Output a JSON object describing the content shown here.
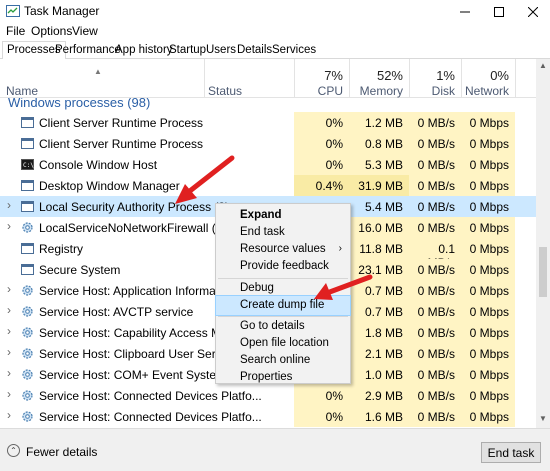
{
  "window": {
    "title": "Task Manager"
  },
  "menu": [
    "File",
    "Options",
    "View"
  ],
  "tabs": [
    "Processes",
    "Performance",
    "App history",
    "Startup",
    "Users",
    "Details",
    "Services"
  ],
  "header": {
    "name": "Name",
    "status": "Status",
    "cpu_pct": "7%",
    "cpu_label": "CPU",
    "mem_pct": "52%",
    "mem_label": "Memory",
    "disk_pct": "1%",
    "disk_label": "Disk",
    "net_pct": "0%",
    "net_label": "Network"
  },
  "group": {
    "title": "Windows processes (98)"
  },
  "processes": [
    {
      "name": "Client Server Runtime Process",
      "cpu": "0%",
      "mem": "1.2 MB",
      "disk": "0 MB/s",
      "net": "0 Mbps",
      "icon": "window-icon",
      "expandable": false
    },
    {
      "name": "Client Server Runtime Process",
      "cpu": "0%",
      "mem": "0.8 MB",
      "disk": "0 MB/s",
      "net": "0 Mbps",
      "icon": "window-icon",
      "expandable": false
    },
    {
      "name": "Console Window Host",
      "cpu": "0%",
      "mem": "5.3 MB",
      "disk": "0 MB/s",
      "net": "0 Mbps",
      "icon": "console-icon",
      "expandable": false
    },
    {
      "name": "Desktop Window Manager",
      "cpu": "0.4%",
      "mem": "31.9 MB",
      "disk": "0 MB/s",
      "net": "0 Mbps",
      "icon": "window-icon",
      "expandable": false
    },
    {
      "name": "Local Security Authority Process (3)",
      "cpu": "",
      "mem": "5.4 MB",
      "disk": "0 MB/s",
      "net": "0 Mbps",
      "icon": "window-icon",
      "expandable": true
    },
    {
      "name": "LocalServiceNoNetworkFirewall (2)",
      "cpu": "",
      "mem": "16.0 MB",
      "disk": "0 MB/s",
      "net": "0 Mbps",
      "icon": "gear-icon",
      "expandable": true
    },
    {
      "name": "Registry",
      "cpu": "",
      "mem": "11.8 MB",
      "disk": "0.1 MB/s",
      "net": "0 Mbps",
      "icon": "window-icon",
      "expandable": false
    },
    {
      "name": "Secure System",
      "cpu": "",
      "mem": "23.1 MB",
      "disk": "0 MB/s",
      "net": "0 Mbps",
      "icon": "window-icon",
      "expandable": false
    },
    {
      "name": "Service Host: Application Information",
      "cpu": "",
      "mem": "0.7 MB",
      "disk": "0 MB/s",
      "net": "0 Mbps",
      "icon": "gear-icon",
      "expandable": true
    },
    {
      "name": "Service Host: AVCTP service",
      "cpu": "",
      "mem": "0.7 MB",
      "disk": "0 MB/s",
      "net": "0 Mbps",
      "icon": "gear-icon",
      "expandable": true
    },
    {
      "name": "Service Host: Capability Access Manag...",
      "cpu": "",
      "mem": "1.8 MB",
      "disk": "0 MB/s",
      "net": "0 Mbps",
      "icon": "gear-icon",
      "expandable": true
    },
    {
      "name": "Service Host: Clipboard User Service_ae...",
      "cpu": "",
      "mem": "2.1 MB",
      "disk": "0 MB/s",
      "net": "0 Mbps",
      "icon": "gear-icon",
      "expandable": true
    },
    {
      "name": "Service Host: COM+ Event System",
      "cpu": "",
      "mem": "1.0 MB",
      "disk": "0 MB/s",
      "net": "0 Mbps",
      "icon": "gear-icon",
      "expandable": true
    },
    {
      "name": "Service Host: Connected Devices Platfo...",
      "cpu": "0%",
      "mem": "2.9 MB",
      "disk": "0 MB/s",
      "net": "0 Mbps",
      "icon": "gear-icon",
      "expandable": true
    },
    {
      "name": "Service Host: Connected Devices Platfo...",
      "cpu": "0%",
      "mem": "1.6 MB",
      "disk": "0 MB/s",
      "net": "0 Mbps",
      "icon": "gear-icon",
      "expandable": true
    }
  ],
  "context_menu": {
    "items": [
      "Expand",
      "End task",
      "Resource values",
      "Provide feedback",
      "Debug",
      "Create dump file",
      "Go to details",
      "Open file location",
      "Search online",
      "Properties"
    ],
    "submenu_glyph": "›"
  },
  "footer": {
    "fewer_details": "Fewer details",
    "end_task": "End task"
  },
  "colors": {
    "accent_arrow": "#e02020",
    "highlight": "#fff4c4",
    "selection": "#cce8ff",
    "group_title": "#2a5fa6"
  }
}
